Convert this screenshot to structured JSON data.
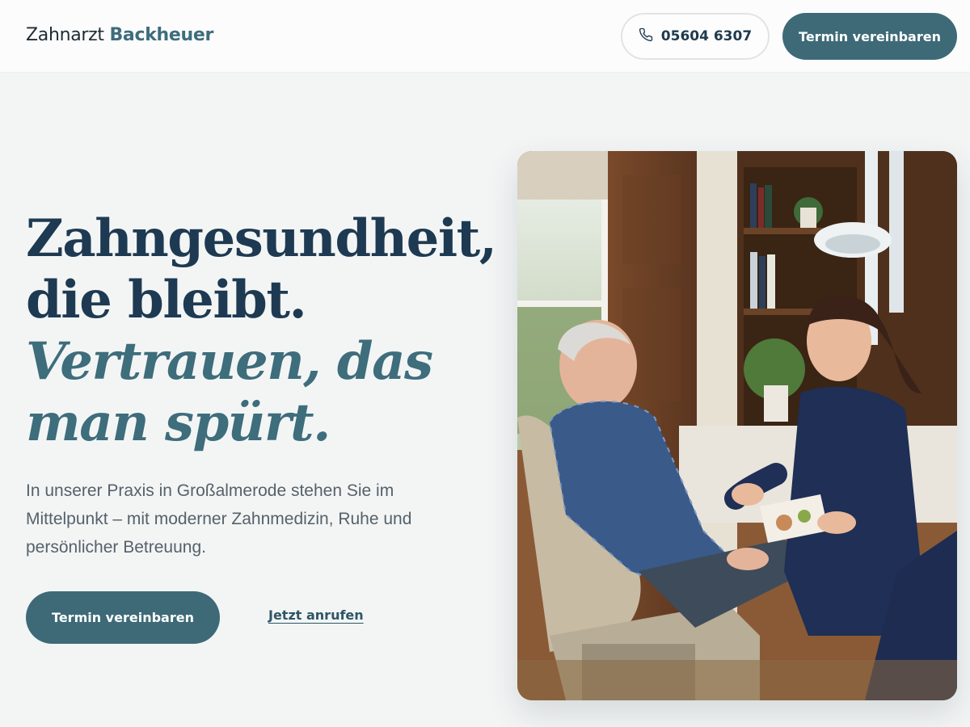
{
  "header": {
    "logo_prefix": "Zahnarzt",
    "logo_brand": "Backheuer",
    "phone_label": "05604 6307",
    "cta_label": "Termin vereinbaren"
  },
  "hero": {
    "title_line1": "Zahngesundheit,",
    "title_line2": "die bleibt.",
    "title_accent_line1": "Vertrauen, das",
    "title_accent_line2": "man spürt.",
    "description": "In unserer Praxis in Großalmerode stehen Sie im Mittelpunkt – mit moderner Zahnmedizin, Ruhe und persönlicher Betreuung.",
    "cta_label": "Termin vereinbaren",
    "call_label": "Jetzt anrufen"
  },
  "icons": {
    "phone": "phone-icon"
  },
  "colors": {
    "accent": "#3e6a78",
    "heading": "#1e3a52",
    "body_text": "#56616a",
    "background": "#f3f5f5"
  }
}
